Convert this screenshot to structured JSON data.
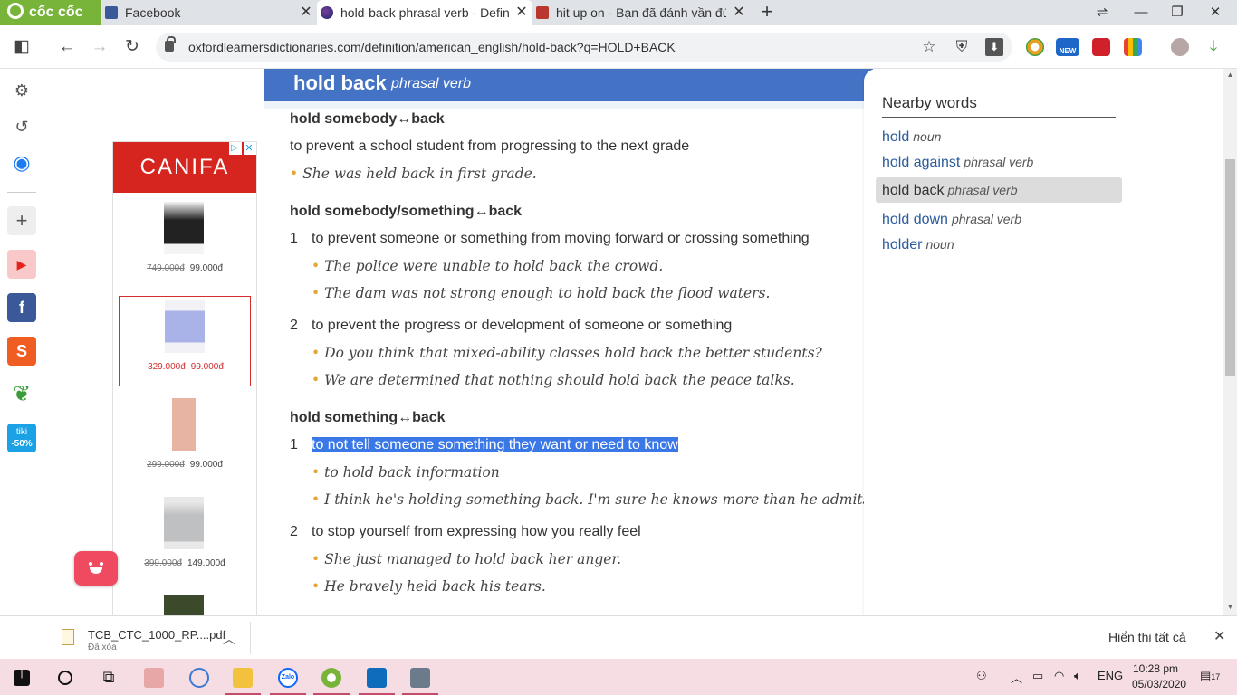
{
  "browser": {
    "brand": "cốc cốc",
    "tabs": [
      {
        "title": "Facebook"
      },
      {
        "title": "hold-back phrasal verb - Definition"
      },
      {
        "title": "hit up on - Bạn đã đánh vần đúng"
      }
    ],
    "new_tab_icon": "plus",
    "url": "oxfordlearnersdictionaries.com/definition/american_english/hold-back?q=HOLD+BACK",
    "new_badge": "NEW"
  },
  "ad": {
    "brand": "CANIFA",
    "choices_icon": "▷",
    "close_icon": "✕",
    "products": [
      {
        "old_price": "749.000đ",
        "price": "99.000đ"
      },
      {
        "old_price": "329.000đ",
        "price": "99.000đ"
      },
      {
        "old_price": "299.000đ",
        "price": "99.000đ"
      },
      {
        "old_price": "399.000đ",
        "price": "149.000đ"
      }
    ]
  },
  "entry": {
    "headword": "hold back",
    "pos": "phrasal verb",
    "s1_head": "hold somebody↔back",
    "s1_def": "to prevent a school student from progressing to the next grade",
    "s1_ex1": "She was held back in first grade.",
    "s2_head": "hold somebody/something↔back",
    "s2_n1": "1",
    "s2_d1": "to prevent someone or something from moving forward or crossing something",
    "s2_ex1": "The police were unable to hold back the crowd.",
    "s2_ex2": "The dam was not strong enough to hold back the flood waters.",
    "s2_n2": "2",
    "s2_d2": "to prevent the progress or development of someone or something",
    "s2_ex3": "Do you think that mixed-ability classes hold back the better students?",
    "s2_ex4": "We are determined that nothing should hold back the peace talks.",
    "s3_head": "hold something↔back",
    "s3_n1": "1",
    "s3_d1": "to not tell someone something they want or need to know",
    "s3_ex1": "to hold back information",
    "s3_ex2": "I think he's holding something back. I'm sure he knows more than he admits.",
    "s3_n2": "2",
    "s3_d2": "to stop yourself from expressing how you really feel",
    "s3_ex3": "She just managed to hold back her anger.",
    "s3_ex4": "He bravely held back his tears.",
    "bullet": "•"
  },
  "nearby": {
    "title": "Nearby words",
    "items": [
      {
        "word": "hold",
        "pos": "noun"
      },
      {
        "word": "hold against",
        "pos": "phrasal verb"
      },
      {
        "word": "hold back",
        "pos": "phrasal verb"
      },
      {
        "word": "hold down",
        "pos": "phrasal verb"
      },
      {
        "word": "holder",
        "pos": "noun"
      }
    ]
  },
  "downloads": {
    "file_name": "TCB_CTC_1000_RP....pdf",
    "status": "Đã xóa",
    "show_all": "Hiển thị tất cả"
  },
  "taskbar": {
    "zalo": "Zalo",
    "language": "ENG",
    "time": "10:28 pm",
    "date": "05/03/2020",
    "notifications": "17"
  },
  "sidebar": {
    "tiki_line1": "tiki",
    "tiki_line2": "-50%"
  },
  "colors": {
    "header_blue": "#4472c4",
    "highlight": "#3b78e7",
    "bullet": "#e3a735",
    "coccoc_green": "#79b43a",
    "canifa_red": "#d6251e"
  }
}
